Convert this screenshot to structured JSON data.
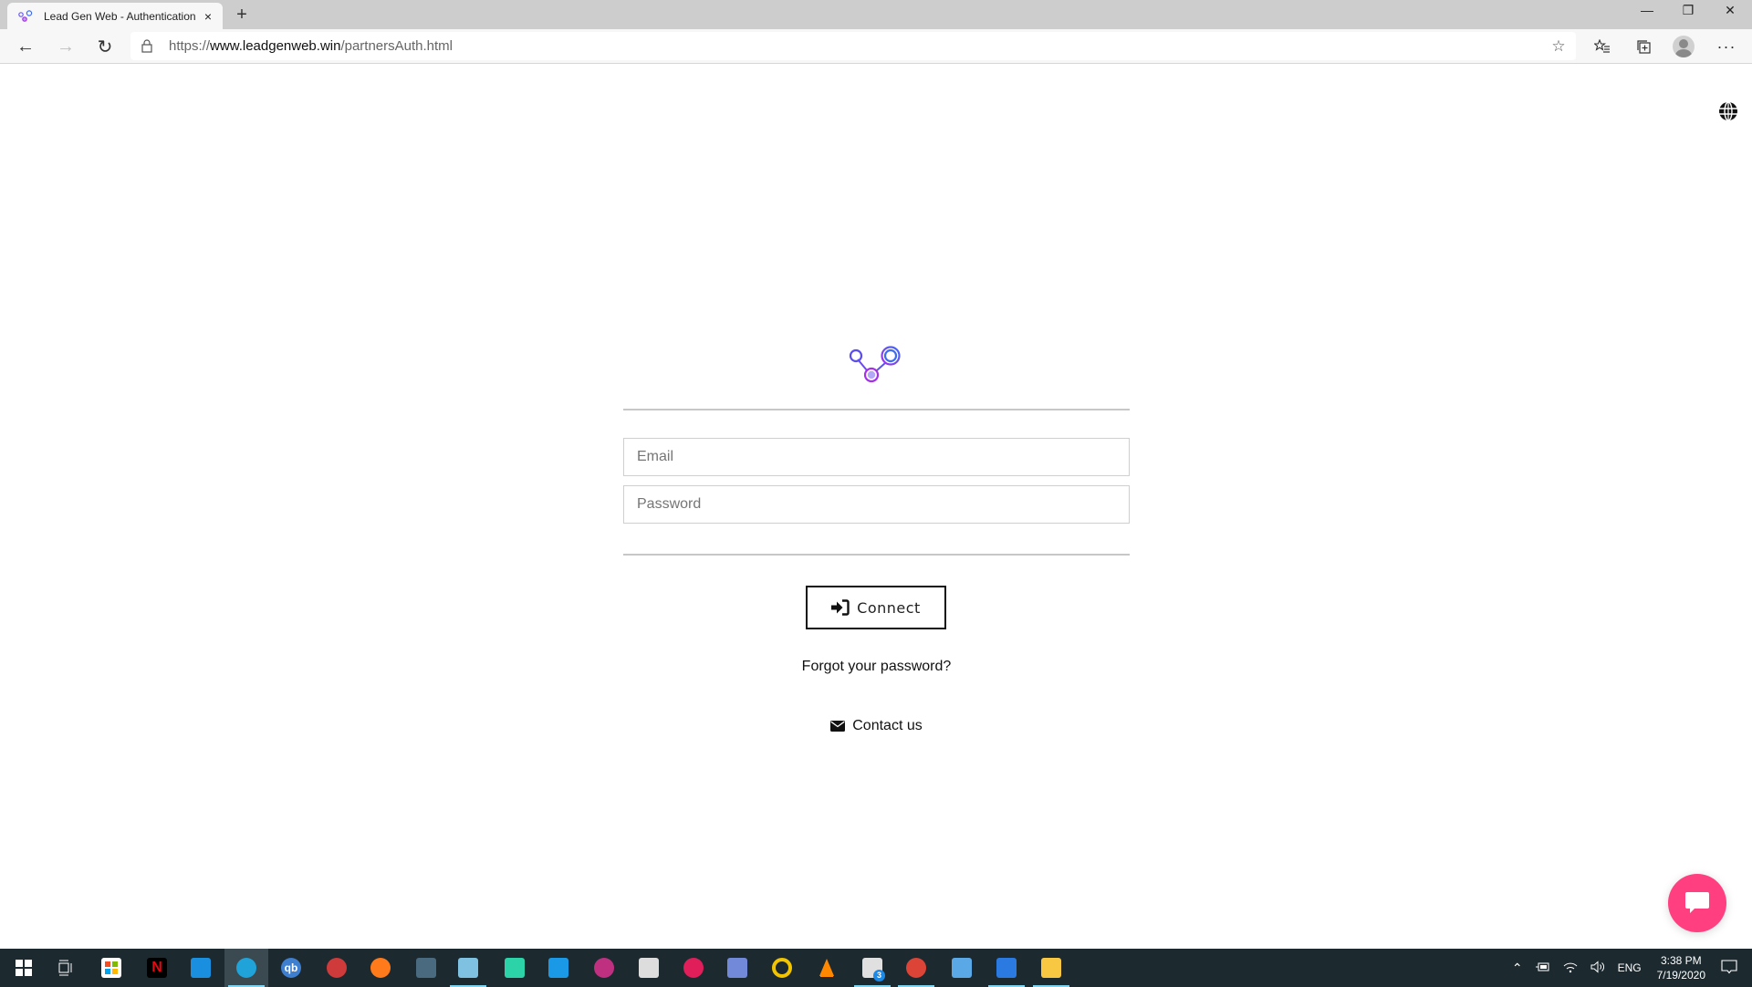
{
  "browser": {
    "tab_title": "Lead Gen Web - Authentication",
    "tab_close": "×",
    "new_tab": "+",
    "url_scheme": "https://",
    "url_host": "www.leadgenweb.win",
    "url_path": "/partnersAuth.html",
    "window_controls": {
      "minimize": "—",
      "restore": "❐",
      "close": "✕"
    },
    "nav": {
      "back": "←",
      "forward": "→",
      "refresh": "↻"
    },
    "toolbar_icons": [
      "favorite-add-icon",
      "favorites-icon",
      "collections-icon",
      "profile-icon",
      "more-icon"
    ],
    "more_label": "···"
  },
  "page": {
    "email_placeholder": "Email",
    "email_value": "",
    "password_placeholder": "Password",
    "password_value": "",
    "connect_label": "Connect",
    "forgot_label": "Forgot your password?",
    "contact_label": "Contact us",
    "colors": {
      "chat_accent": "#ff3f80",
      "logo_blue": "#3d6cf0",
      "logo_purple": "#a431e8"
    }
  },
  "taskbar": {
    "apps": [
      {
        "name": "start",
        "color": "#ffffff"
      },
      {
        "name": "task-view",
        "color": "#ffffff"
      },
      {
        "name": "microsoft-store",
        "color": "#ffffff"
      },
      {
        "name": "netflix",
        "color": "#e50914",
        "glyph": "N"
      },
      {
        "name": "mail",
        "color": "#1a8fdf"
      },
      {
        "name": "edge",
        "color": "#1fa3d8",
        "active": true
      },
      {
        "name": "qbittorrent",
        "color": "#3e7fd0",
        "glyph": "qb"
      },
      {
        "name": "app-ring",
        "color": "#cf3a3a"
      },
      {
        "name": "firefox",
        "color": "#ff7a1a"
      },
      {
        "name": "calculator",
        "color": "#4a6a80"
      },
      {
        "name": "notepad",
        "color": "#7fc1e0",
        "underline": true
      },
      {
        "name": "filmora",
        "color": "#2dd3a8"
      },
      {
        "name": "zoom-video",
        "color": "#1a9ae6"
      },
      {
        "name": "davinci-resolve",
        "color": "#c03080"
      },
      {
        "name": "app-cube",
        "color": "#dddddd"
      },
      {
        "name": "slack",
        "color": "#e01e5a"
      },
      {
        "name": "discord",
        "color": "#7289da"
      },
      {
        "name": "app-circle",
        "color": "#f2c500"
      },
      {
        "name": "vlc",
        "color": "#ff8800"
      },
      {
        "name": "mail-badge",
        "color": "#e0e0e0",
        "badge": "3",
        "underline": true
      },
      {
        "name": "chrome",
        "color": "#db4437",
        "underline": true
      },
      {
        "name": "remote-desktop",
        "color": "#5aa9e6"
      },
      {
        "name": "writer",
        "color": "#2a7ae2",
        "underline": true
      },
      {
        "name": "file-explorer",
        "color": "#f8c843",
        "underline": true
      }
    ],
    "tray": {
      "chevron": "^",
      "language": "ENG",
      "time": "3:38 PM",
      "date": "7/19/2020"
    }
  }
}
